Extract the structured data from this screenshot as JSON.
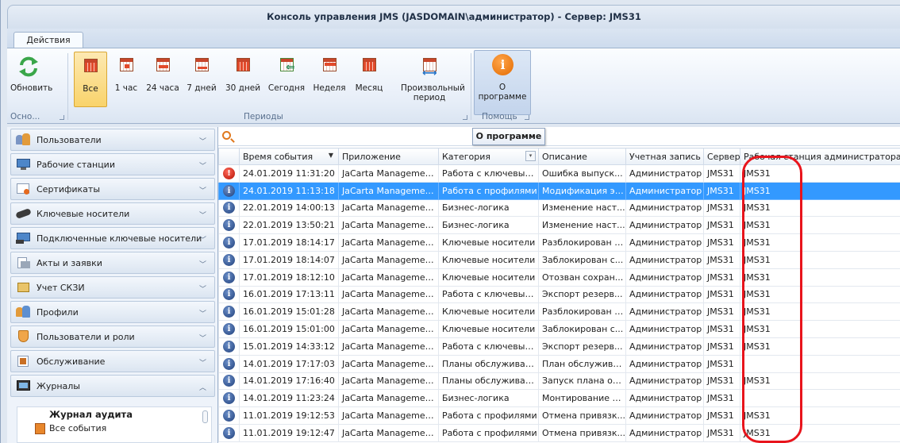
{
  "window": {
    "title": "Консоль управления JMS (JASDOMAIN\\администратор) - Сервер: JMS31"
  },
  "ribbon": {
    "tab": "Действия",
    "buttons": [
      {
        "label": "Обновить"
      },
      {
        "label": "Все"
      },
      {
        "label": "1 час"
      },
      {
        "label": "24 часа"
      },
      {
        "label": "7 дней"
      },
      {
        "label": "30 дней"
      },
      {
        "label": "Сегодня"
      },
      {
        "label": "Неделя"
      },
      {
        "label": "Месяц"
      },
      {
        "label": "Произвольный период"
      },
      {
        "label": "О программе"
      }
    ],
    "groups": {
      "main": "Осно...",
      "periods": "Периоды",
      "help": "Помощь"
    }
  },
  "nav": {
    "items": [
      {
        "label": "Пользователи",
        "icon": "users-icon"
      },
      {
        "label": "Рабочие станции",
        "icon": "workstations-icon"
      },
      {
        "label": "Сертификаты",
        "icon": "certificate-icon"
      },
      {
        "label": "Ключевые носители",
        "icon": "token-icon"
      },
      {
        "label": "Подключенные ключевые носители",
        "icon": "connected-token-icon"
      },
      {
        "label": "Акты и заявки",
        "icon": "documents-icon"
      },
      {
        "label": "Учет СКЗИ",
        "icon": "crypto-accounting-icon"
      },
      {
        "label": "Профили",
        "icon": "profiles-icon"
      },
      {
        "label": "Пользователи и роли",
        "icon": "roles-icon"
      },
      {
        "label": "Обслуживание",
        "icon": "maintenance-icon"
      },
      {
        "label": "Журналы",
        "icon": "journals-icon"
      }
    ],
    "sub_title": "Журнал аудита",
    "sub_item": "Все события"
  },
  "tooltip": "О программе",
  "grid": {
    "columns": [
      "",
      "Время события",
      "Приложение",
      "Категория",
      "Описание",
      "Учетная запись",
      "Сервер",
      "Рабочая станция администратора"
    ],
    "rows": [
      {
        "type": "error",
        "time": "24.01.2019 11:31:20",
        "app": "JaCarta Management...",
        "category": "Работа с ключевым...",
        "desc": "Ошибка выпуск...",
        "account": "Администратор",
        "server": "JMS31",
        "ws": "JMS31"
      },
      {
        "type": "info",
        "time": "24.01.2019 11:13:18",
        "app": "JaCarta Management...",
        "category": "Работа с профилями",
        "desc": "Модификация эк...",
        "account": "Администратор",
        "server": "JMS31",
        "ws": "JMS31"
      },
      {
        "type": "info",
        "time": "22.01.2019 14:00:13",
        "app": "JaCarta Management...",
        "category": "Бизнес-логика",
        "desc": "Изменение наст...",
        "account": "Администратор",
        "server": "JMS31",
        "ws": "JMS31"
      },
      {
        "type": "info",
        "time": "22.01.2019 13:50:21",
        "app": "JaCarta Management...",
        "category": "Бизнес-логика",
        "desc": "Изменение наст...",
        "account": "Администратор",
        "server": "JMS31",
        "ws": "JMS31"
      },
      {
        "type": "info",
        "time": "17.01.2019 18:14:17",
        "app": "JaCarta Management...",
        "category": "Ключевые носители",
        "desc": "Разблокирован с...",
        "account": "Администратор",
        "server": "JMS31",
        "ws": "JMS31"
      },
      {
        "type": "info",
        "time": "17.01.2019 18:14:07",
        "app": "JaCarta Management...",
        "category": "Ключевые носители",
        "desc": "Заблокирован с...",
        "account": "Администратор",
        "server": "JMS31",
        "ws": "JMS31"
      },
      {
        "type": "info",
        "time": "17.01.2019 18:12:10",
        "app": "JaCarta Management...",
        "category": "Ключевые носители",
        "desc": "Отозван сохран...",
        "account": "Администратор",
        "server": "JMS31",
        "ws": "JMS31"
      },
      {
        "type": "info",
        "time": "16.01.2019 17:13:11",
        "app": "JaCarta Management...",
        "category": "Работа с ключевым...",
        "desc": "Экспорт резерв...",
        "account": "Администратор",
        "server": "JMS31",
        "ws": "JMS31"
      },
      {
        "type": "info",
        "time": "16.01.2019 15:01:28",
        "app": "JaCarta Management...",
        "category": "Ключевые носители",
        "desc": "Разблокирован с...",
        "account": "Администратор",
        "server": "JMS31",
        "ws": "JMS31"
      },
      {
        "type": "info",
        "time": "16.01.2019 15:01:00",
        "app": "JaCarta Management...",
        "category": "Ключевые носители",
        "desc": "Заблокирован с...",
        "account": "Администратор",
        "server": "JMS31",
        "ws": "JMS31"
      },
      {
        "type": "info",
        "time": "15.01.2019 14:33:12",
        "app": "JaCarta Management...",
        "category": "Работа с ключевым...",
        "desc": "Экспорт резерв...",
        "account": "Администратор",
        "server": "JMS31",
        "ws": "JMS31"
      },
      {
        "type": "info",
        "time": "14.01.2019 17:17:03",
        "app": "JaCarta Management...",
        "category": "Планы обслуживания",
        "desc": "План обслужива...",
        "account": "Администратор",
        "server": "JMS31",
        "ws": ""
      },
      {
        "type": "info",
        "time": "14.01.2019 17:16:40",
        "app": "JaCarta Management...",
        "category": "Планы обслуживания",
        "desc": "Запуск плана об...",
        "account": "Администратор",
        "server": "JMS31",
        "ws": "JMS31"
      },
      {
        "type": "info",
        "time": "14.01.2019 11:23:24",
        "app": "JaCarta Management...",
        "category": "Бизнес-логика",
        "desc": "Монтирование к...",
        "account": "Администратор",
        "server": "JMS31",
        "ws": ""
      },
      {
        "type": "info",
        "time": "11.01.2019 19:12:53",
        "app": "JaCarta Management...",
        "category": "Работа с профилями",
        "desc": "Отмена привязк...",
        "account": "Администратор",
        "server": "JMS31",
        "ws": "JMS31"
      },
      {
        "type": "info",
        "time": "11.01.2019 19:12:47",
        "app": "JaCarta Management...",
        "category": "Работа с профилями",
        "desc": "Отмена привязк...",
        "account": "Администратор",
        "server": "JMS31",
        "ws": "JMS31"
      }
    ],
    "selected_row": 1
  },
  "colors": {
    "selection": "#3399ff",
    "annotation": "#e8141c",
    "accent": "#f9d36b"
  }
}
